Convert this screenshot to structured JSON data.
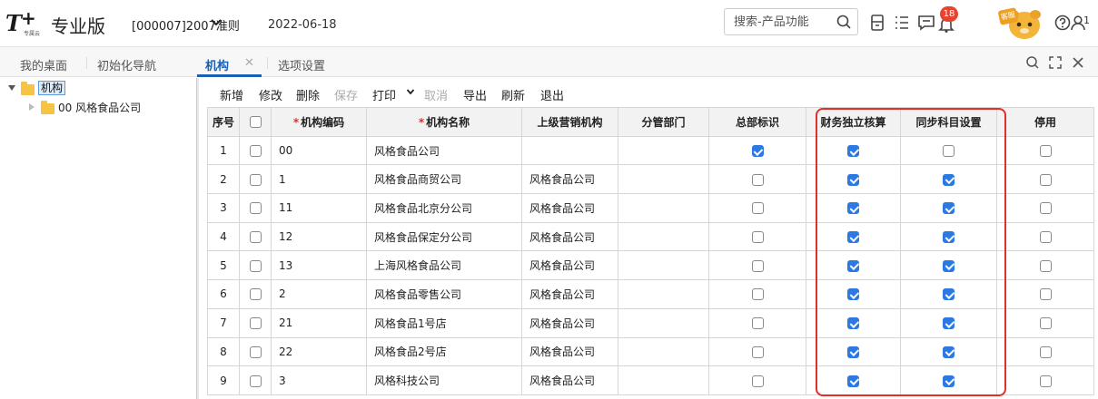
{
  "header": {
    "logo_sub": "专属云",
    "edition": "专业版",
    "account": "[000007]2007准则",
    "date": "2022-06-18",
    "search_placeholder": "搜索-产品功能",
    "notification_count": "18",
    "service_label": "客服",
    "user_number": "1",
    "icons": [
      "search-icon",
      "calculator-icon",
      "task-list-icon",
      "message-icon",
      "bell-icon",
      "help-icon",
      "user-icon"
    ]
  },
  "tabs": {
    "items": [
      {
        "label": "我的桌面"
      },
      {
        "label": "初始化导航"
      },
      {
        "label": "机构"
      },
      {
        "label": "选项设置"
      }
    ],
    "close_glyph": "✕"
  },
  "tree": {
    "root": {
      "label": "机构"
    },
    "child": {
      "label": "00 风格食品公司"
    }
  },
  "toolbar": {
    "add": "新增",
    "edit": "修改",
    "delete": "删除",
    "save": "保存",
    "print": "打印",
    "cancel": "取消",
    "export": "导出",
    "refresh": "刷新",
    "exit": "退出"
  },
  "grid": {
    "columns": {
      "seq": "序号",
      "code": "机构编码",
      "name": "机构名称",
      "parent": "上级营销机构",
      "dept": "分管部门",
      "hq": "总部标识",
      "indep": "财务独立核算",
      "sync": "同步科目设置",
      "disabled": "停用"
    },
    "rows": [
      {
        "seq": "1",
        "code": "00",
        "name": "风格食品公司",
        "parent": "",
        "dept": "",
        "hq": true,
        "indep": true,
        "sync": false,
        "disabled": false
      },
      {
        "seq": "2",
        "code": "1",
        "name": "风格食品商贸公司",
        "parent": "风格食品公司",
        "dept": "",
        "hq": false,
        "indep": true,
        "sync": true,
        "disabled": false
      },
      {
        "seq": "3",
        "code": "11",
        "name": "风格食品北京分公司",
        "parent": "风格食品公司",
        "dept": "",
        "hq": false,
        "indep": true,
        "sync": true,
        "disabled": false
      },
      {
        "seq": "4",
        "code": "12",
        "name": "风格食品保定分公司",
        "parent": "风格食品公司",
        "dept": "",
        "hq": false,
        "indep": true,
        "sync": true,
        "disabled": false
      },
      {
        "seq": "5",
        "code": "13",
        "name": "上海风格食品公司",
        "parent": "风格食品公司",
        "dept": "",
        "hq": false,
        "indep": true,
        "sync": true,
        "disabled": false
      },
      {
        "seq": "6",
        "code": "2",
        "name": "风格食品零售公司",
        "parent": "风格食品公司",
        "dept": "",
        "hq": false,
        "indep": true,
        "sync": true,
        "disabled": false
      },
      {
        "seq": "7",
        "code": "21",
        "name": "风格食品1号店",
        "parent": "风格食品公司",
        "dept": "",
        "hq": false,
        "indep": true,
        "sync": true,
        "disabled": false
      },
      {
        "seq": "8",
        "code": "22",
        "name": "风格食品2号店",
        "parent": "风格食品公司",
        "dept": "",
        "hq": false,
        "indep": true,
        "sync": true,
        "disabled": false
      },
      {
        "seq": "9",
        "code": "3",
        "name": "风格科技公司",
        "parent": "风格食品公司",
        "dept": "",
        "hq": false,
        "indep": true,
        "sync": true,
        "disabled": false
      }
    ]
  },
  "colors": {
    "accent": "#1a5fb4",
    "checkbox_on": "#2b7ae4",
    "highlight": "#e0302a",
    "badge": "#e8432f",
    "folder": "#f6c343"
  }
}
